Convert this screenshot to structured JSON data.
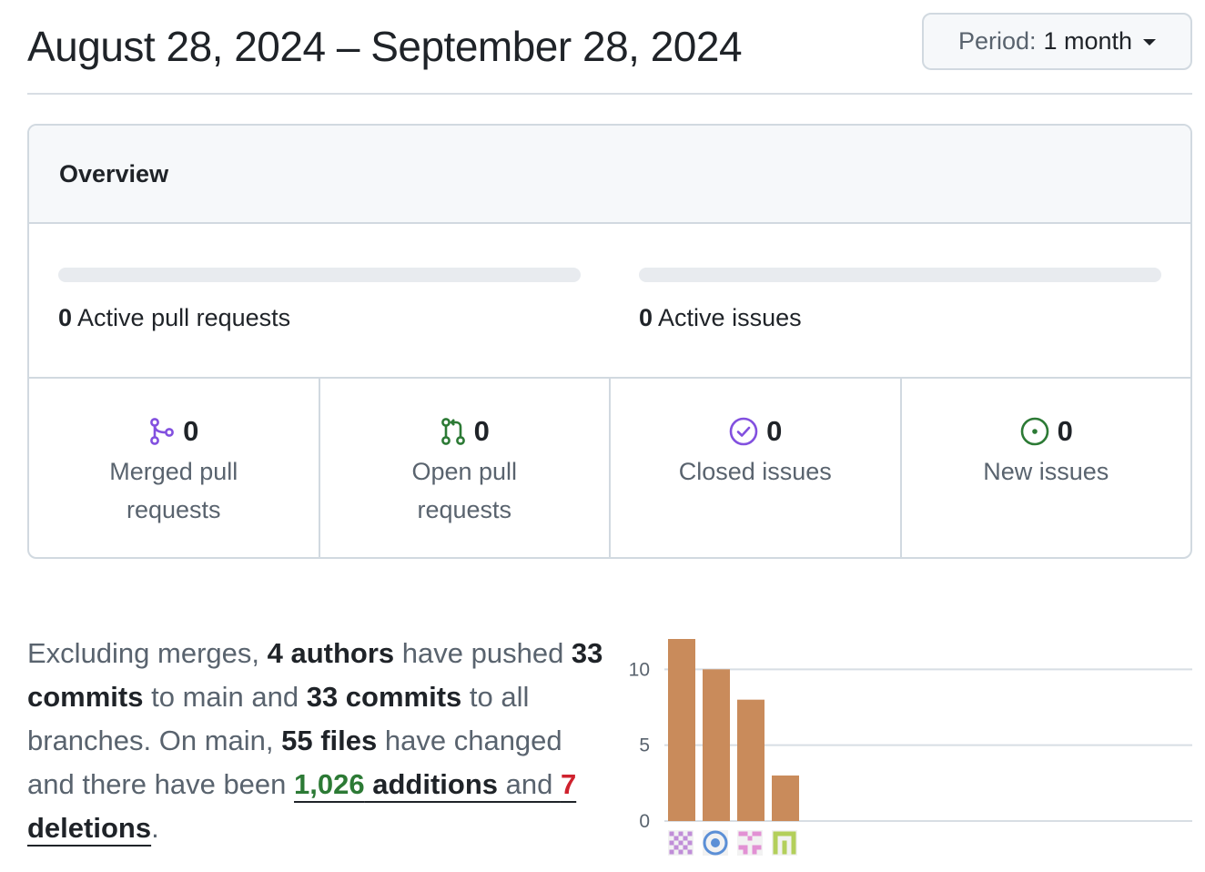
{
  "header": {
    "date_range": "August 28, 2024 – September 28, 2024",
    "period_prefix": "Period:",
    "period_value": "1 month"
  },
  "overview": {
    "title": "Overview",
    "active_prs": {
      "count": "0",
      "label": "Active pull requests"
    },
    "active_issues": {
      "count": "0",
      "label": "Active issues"
    },
    "stats": [
      {
        "icon": "git-merge-icon",
        "color": "#8250df",
        "count": "0",
        "label": "Merged pull requests"
      },
      {
        "icon": "git-pull-request-icon",
        "color": "#2c7a35",
        "count": "0",
        "label": "Open pull requests"
      },
      {
        "icon": "issue-closed-icon",
        "color": "#8250df",
        "count": "0",
        "label": "Closed issues"
      },
      {
        "icon": "issue-opened-icon",
        "color": "#2c7a35",
        "count": "0",
        "label": "New issues"
      }
    ]
  },
  "summary": {
    "t1": "Excluding merges, ",
    "authors": "4 authors",
    "t2": " have pushed ",
    "commits_main": "33 commits",
    "t3": " to main and ",
    "commits_all": "33 commits",
    "t4": " to all branches. On main, ",
    "files": "55 files",
    "t5": " have changed and there have been ",
    "additions_num": "1,026",
    "additions_word": " additions",
    "t6": " and ",
    "deletions_num": "7",
    "deletions_word": " deletions",
    "t7": "."
  },
  "chart_data": {
    "type": "bar",
    "categories": [
      "author-1",
      "author-2",
      "author-3",
      "author-4"
    ],
    "values": [
      12,
      10,
      8,
      3
    ],
    "ylim": [
      0,
      12
    ],
    "yticks": [
      0,
      5,
      10
    ],
    "bar_color": "#c98b5b",
    "grid": true,
    "title": "",
    "xlabel": "",
    "ylabel": ""
  },
  "avatars": [
    {
      "name": "avatar-identicon-purple",
      "color": "#c08ed8"
    },
    {
      "name": "avatar-dragon-blue",
      "color": "#5b8fd6"
    },
    {
      "name": "avatar-identicon-pink",
      "color": "#e291d4"
    },
    {
      "name": "avatar-identicon-green",
      "color": "#b3cf5b"
    }
  ]
}
